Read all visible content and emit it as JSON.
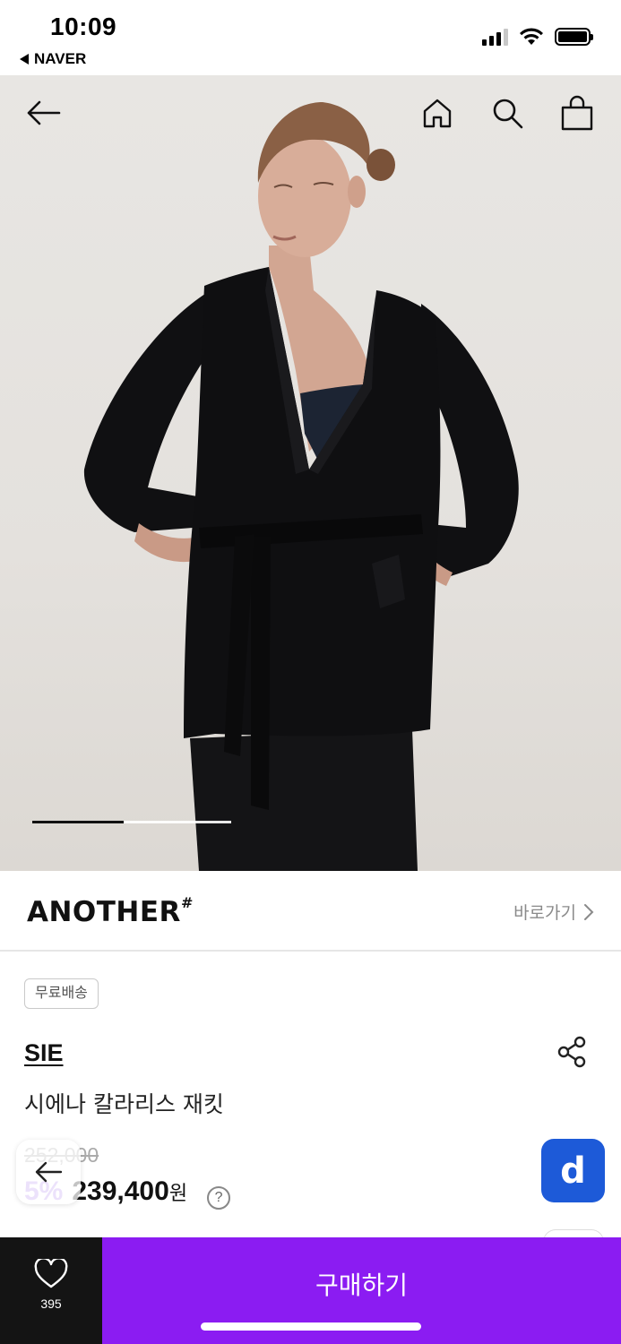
{
  "status_bar": {
    "time": "10:09",
    "back_app": "NAVER",
    "icons": [
      "cellular-signal-icon",
      "wifi-icon",
      "battery-icon"
    ]
  },
  "hero": {
    "nav_icons": [
      "arrow-left-icon",
      "home-icon",
      "search-icon",
      "shopping-bag-icon"
    ],
    "slide_indicator": {
      "active_fraction": 0.46
    }
  },
  "brand_row": {
    "brand_name": "ANOTHER",
    "brand_mark": "#",
    "link_label": "바로가기",
    "link_icon": "chevron-right-icon"
  },
  "product": {
    "badge": "무료배송",
    "brand": "SIE",
    "title": "시에나 칼라리스 재킷",
    "original_price": "252,000",
    "discount": "5%",
    "price": "239,400",
    "currency": "원",
    "help_label": "?"
  },
  "floating": {
    "back_icon": "arrow-left-icon",
    "app_button_label": "d"
  },
  "bottom_bar": {
    "like_count": "395",
    "buy_label": "구매하기"
  },
  "colors": {
    "buy_purple": "#8b1cf2",
    "discount_purple": "#b48af0",
    "app_button_blue": "#1d5ad8",
    "like_bg": "#141414"
  }
}
